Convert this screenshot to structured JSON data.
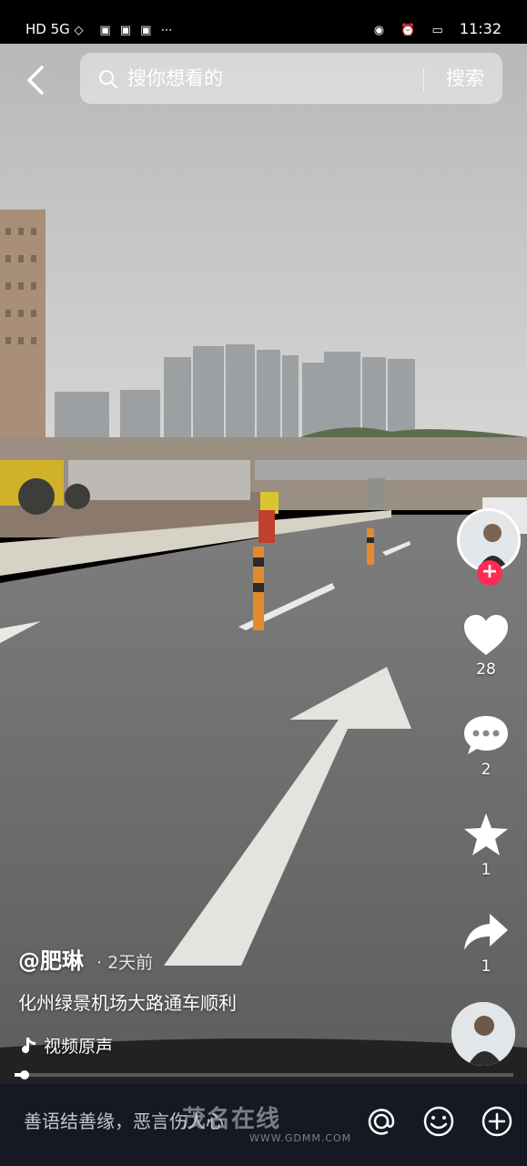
{
  "status_bar": {
    "left_icons": [
      "hd-icon",
      "signal-icon",
      "wifi-icon",
      "app-icons"
    ],
    "left_text": "HD 5G",
    "time": "11:32"
  },
  "search": {
    "placeholder": "搜你想看的",
    "button": "搜索"
  },
  "rail": {
    "likes": "28",
    "comments": "2",
    "favorites": "1",
    "shares": "1"
  },
  "video": {
    "author": "@肥琳",
    "time": "· 2天前",
    "description": "化州绿景机场大路通车顺利",
    "music": "视频原声",
    "progress": 0.02
  },
  "bottom_bar": {
    "comment_placeholder": "善语结善缘，恶言伤人心"
  },
  "watermark": {
    "brand": "茂名在线",
    "url": "WWW.GDMM.COM"
  },
  "colors": {
    "follow": "#fe2c55",
    "bottom_bar_bg": "#161823"
  }
}
